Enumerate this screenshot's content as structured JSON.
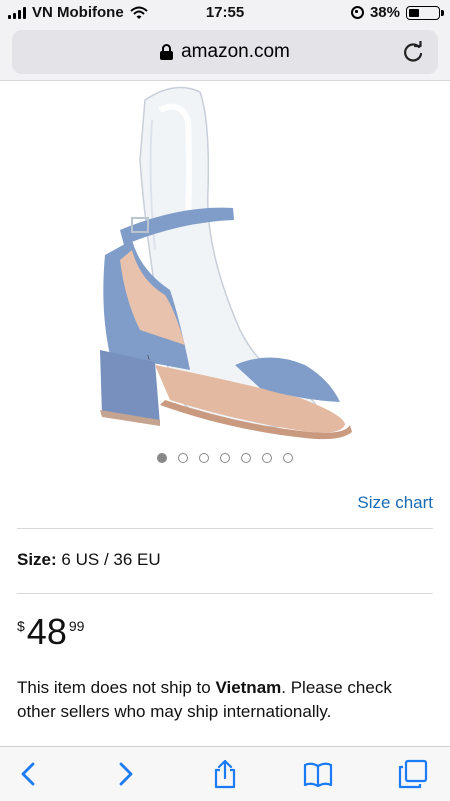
{
  "status_bar": {
    "carrier": "VN Mobifone",
    "time": "17:55",
    "battery_percent": "38%",
    "battery_level": 0.38
  },
  "browser": {
    "url": "amazon.com"
  },
  "product": {
    "image_carousel": {
      "dot_count": 7,
      "active_index": 0
    },
    "size_chart_link": "Size chart",
    "size_label": "Size:",
    "size_value": "6 US / 36 EU",
    "price": {
      "symbol": "$",
      "whole": "48",
      "fraction": "99"
    },
    "shipping_note": {
      "before": "This item does not ship to ",
      "country": "Vietnam",
      "after": ". Please check other sellers who may ship internationally."
    }
  },
  "colors": {
    "link_blue": "#1a6bb5",
    "toolbar_blue": "#1a7bf5",
    "denim": "#7f9dc8"
  },
  "icons": {
    "back": "chevron-left-icon",
    "forward": "chevron-right-icon",
    "share": "share-icon",
    "bookmarks": "book-icon",
    "tabs": "tabs-icon",
    "reload": "reload-icon",
    "lock": "lock-icon",
    "wifi": "wifi-icon"
  }
}
